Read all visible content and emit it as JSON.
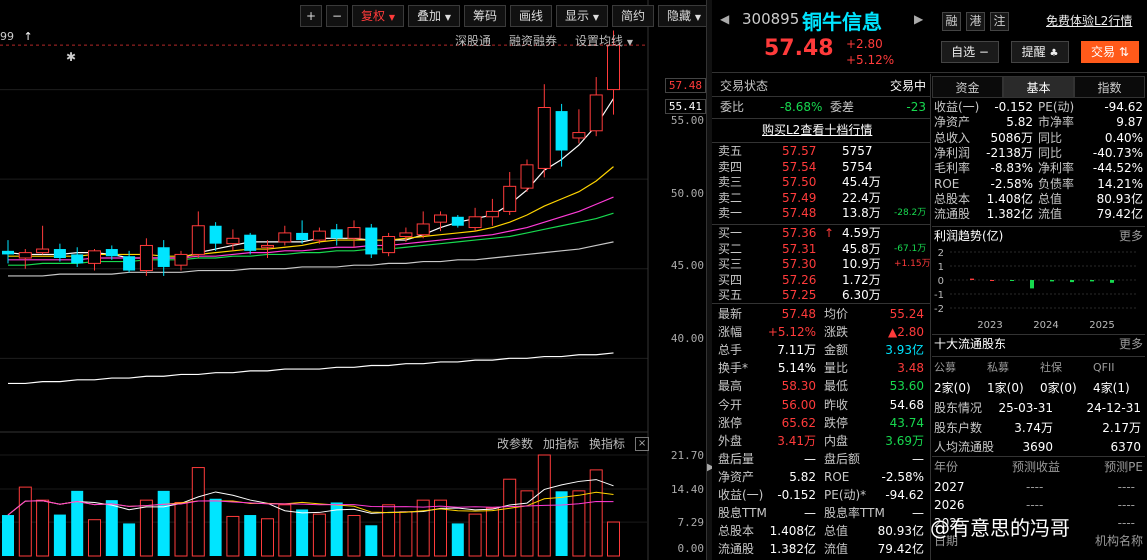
{
  "toolbar": {
    "plus": "+",
    "minus": "−",
    "buttons": [
      "复权",
      "叠加",
      "筹码",
      "画线",
      "显示",
      "简约",
      "隐藏"
    ],
    "arrows": "◀▶",
    "sub": [
      "深股通",
      "融资融券",
      "设置均线"
    ],
    "top_left": "99",
    "top_left_arrow": "↑"
  },
  "price_axis": {
    "ticks": [
      "55.00",
      "50.00",
      "45.00",
      "40.00"
    ],
    "current_tag": "57.48",
    "cross_tag": "55.41",
    "vol_ticks": [
      "21.70",
      "14.40",
      "7.29",
      "0.00"
    ]
  },
  "indicator_bar": [
    "改参数",
    "加指标",
    "换指标"
  ],
  "indicator_close": "×",
  "chart_data": {
    "type": "candlestick",
    "ylim": [
      36,
      60
    ],
    "candles": [
      {
        "o": 46.0,
        "h": 46.6,
        "l": 45.3,
        "c": 45.8
      },
      {
        "o": 45.6,
        "h": 46.1,
        "l": 45.0,
        "c": 45.9
      },
      {
        "o": 45.9,
        "h": 47.4,
        "l": 45.8,
        "c": 46.1
      },
      {
        "o": 46.1,
        "h": 46.4,
        "l": 45.4,
        "c": 45.6
      },
      {
        "o": 45.8,
        "h": 46.2,
        "l": 45.1,
        "c": 45.3
      },
      {
        "o": 45.3,
        "h": 46.1,
        "l": 44.9,
        "c": 46.0
      },
      {
        "o": 46.1,
        "h": 46.3,
        "l": 45.5,
        "c": 45.7
      },
      {
        "o": 45.7,
        "h": 46.0,
        "l": 44.8,
        "c": 44.9
      },
      {
        "o": 44.9,
        "h": 46.7,
        "l": 44.6,
        "c": 46.3
      },
      {
        "o": 46.2,
        "h": 46.6,
        "l": 44.6,
        "c": 45.1
      },
      {
        "o": 45.2,
        "h": 46.0,
        "l": 44.9,
        "c": 45.8
      },
      {
        "o": 45.8,
        "h": 48.2,
        "l": 45.6,
        "c": 47.4
      },
      {
        "o": 47.4,
        "h": 47.6,
        "l": 46.0,
        "c": 46.4
      },
      {
        "o": 46.4,
        "h": 47.2,
        "l": 46.0,
        "c": 46.7
      },
      {
        "o": 46.9,
        "h": 47.0,
        "l": 45.8,
        "c": 46.0
      },
      {
        "o": 46.2,
        "h": 46.6,
        "l": 45.6,
        "c": 46.3
      },
      {
        "o": 46.5,
        "h": 47.4,
        "l": 46.3,
        "c": 47.0
      },
      {
        "o": 47.0,
        "h": 47.7,
        "l": 46.4,
        "c": 46.6
      },
      {
        "o": 46.6,
        "h": 47.3,
        "l": 46.4,
        "c": 47.1
      },
      {
        "o": 47.2,
        "h": 47.5,
        "l": 46.3,
        "c": 46.7
      },
      {
        "o": 46.7,
        "h": 47.7,
        "l": 46.2,
        "c": 47.3
      },
      {
        "o": 47.3,
        "h": 47.5,
        "l": 45.6,
        "c": 45.8
      },
      {
        "o": 45.9,
        "h": 47.0,
        "l": 45.7,
        "c": 46.8
      },
      {
        "o": 46.8,
        "h": 47.3,
        "l": 46.5,
        "c": 47.0
      },
      {
        "o": 46.9,
        "h": 48.2,
        "l": 46.7,
        "c": 47.5
      },
      {
        "o": 47.6,
        "h": 48.2,
        "l": 47.1,
        "c": 48.0
      },
      {
        "o": 47.9,
        "h": 48.0,
        "l": 47.3,
        "c": 47.4
      },
      {
        "o": 47.3,
        "h": 48.4,
        "l": 47.1,
        "c": 47.9
      },
      {
        "o": 47.9,
        "h": 48.9,
        "l": 47.4,
        "c": 48.2
      },
      {
        "o": 48.2,
        "h": 50.4,
        "l": 48.0,
        "c": 49.6
      },
      {
        "o": 49.5,
        "h": 51.1,
        "l": 49.3,
        "c": 50.8
      },
      {
        "o": 50.6,
        "h": 55.3,
        "l": 50.1,
        "c": 54.0
      },
      {
        "o": 53.8,
        "h": 54.2,
        "l": 50.7,
        "c": 51.6
      },
      {
        "o": 52.3,
        "h": 53.9,
        "l": 52.0,
        "c": 52.6
      },
      {
        "o": 52.7,
        "h": 55.7,
        "l": 52.4,
        "c": 54.7
      },
      {
        "o": 55.0,
        "h": 58.3,
        "l": 53.6,
        "c": 57.48
      }
    ],
    "ma": [
      {
        "name": "MA5",
        "color": "#ffffff",
        "values": [
          45.9,
          45.8,
          45.8,
          45.8,
          45.9,
          45.9,
          45.8,
          45.6,
          45.6,
          45.6,
          45.6,
          45.9,
          46.1,
          46.3,
          46.5,
          46.5,
          46.5,
          46.5,
          46.7,
          46.7,
          46.7,
          46.6,
          46.6,
          46.6,
          46.9,
          47.3,
          47.6,
          47.8,
          48.0,
          48.6,
          49.4,
          50.5,
          51.1,
          51.9,
          53.0,
          54.5
        ]
      },
      {
        "name": "MA10",
        "color": "#ffd400",
        "values": [
          45.7,
          45.7,
          45.7,
          45.7,
          45.7,
          45.8,
          45.8,
          45.8,
          45.8,
          45.7,
          45.7,
          45.8,
          45.9,
          46.0,
          46.1,
          46.1,
          46.2,
          46.3,
          46.5,
          46.6,
          46.6,
          46.6,
          46.6,
          46.7,
          46.8,
          46.9,
          47.0,
          47.1,
          47.3,
          47.6,
          48.0,
          48.5,
          48.9,
          49.3,
          49.9,
          50.7
        ]
      },
      {
        "name": "MA20",
        "color": "#ff3bd7",
        "values": [
          45.5,
          45.5,
          45.5,
          45.5,
          45.5,
          45.6,
          45.6,
          45.6,
          45.6,
          45.6,
          45.6,
          45.7,
          45.7,
          45.8,
          45.9,
          45.9,
          46.0,
          46.0,
          46.1,
          46.2,
          46.2,
          46.3,
          46.3,
          46.4,
          46.5,
          46.6,
          46.7,
          46.8,
          46.9,
          47.1,
          47.3,
          47.6,
          47.9,
          48.2,
          48.6,
          49.0
        ]
      },
      {
        "name": "MA30",
        "color": "#17d94f",
        "values": [
          45.2,
          45.2,
          45.3,
          45.3,
          45.3,
          45.4,
          45.4,
          45.4,
          45.5,
          45.5,
          45.5,
          45.6,
          45.6,
          45.7,
          45.7,
          45.8,
          45.8,
          45.9,
          45.9,
          46.0,
          46.0,
          46.1,
          46.1,
          46.2,
          46.3,
          46.4,
          46.5,
          46.6,
          46.7,
          46.8,
          47.0,
          47.2,
          47.4,
          47.6,
          47.8,
          48.1
        ]
      },
      {
        "name": "MA60",
        "color": "#c8c8c8",
        "values": [
          44.6,
          44.6,
          44.6,
          44.7,
          44.7,
          44.7,
          44.7,
          44.8,
          44.8,
          44.8,
          44.8,
          44.9,
          44.9,
          44.9,
          45.0,
          45.0,
          45.0,
          45.1,
          45.1,
          45.1,
          45.2,
          45.2,
          45.3,
          45.3,
          45.4,
          45.4,
          45.5,
          45.5,
          45.6,
          45.7,
          45.8,
          45.9,
          46.0,
          46.1,
          46.3,
          46.5
        ]
      },
      {
        "name": "MA250",
        "color": "#ffffff",
        "values": [
          38.6,
          38.6,
          38.7,
          38.7,
          38.8,
          38.8,
          38.9,
          38.9,
          39.0,
          39.0,
          39.1,
          39.1,
          39.2,
          39.2,
          39.3,
          39.3,
          39.4,
          39.4,
          39.4,
          39.5,
          39.5,
          39.6,
          39.6,
          39.7,
          39.7,
          39.8,
          39.8,
          39.9,
          39.9,
          40.0,
          40.0,
          40.1,
          40.1,
          40.2,
          40.2,
          40.3
        ]
      }
    ],
    "volume": [
      8.8,
      14.8,
      12.0,
      8.9,
      14.0,
      7.8,
      12.0,
      7.0,
      12.0,
      14.0,
      11.5,
      19.0,
      12.3,
      8.5,
      8.8,
      8.0,
      11.0,
      10.0,
      9.0,
      11.5,
      8.7,
      6.6,
      11.0,
      9.5,
      12.0,
      12.0,
      7.0,
      9.0,
      10.3,
      16.5,
      14.0,
      21.7,
      13.9,
      14.0,
      18.5,
      7.3
    ],
    "vol_ylim": [
      0,
      21.7
    ]
  },
  "header": {
    "code": "300895",
    "name": "铜牛信息",
    "badges": [
      "融",
      "港",
      "注"
    ],
    "l2_link": "免费体验L2行情",
    "price": "57.48",
    "change": "+2.80",
    "change_pct": "+5.12%",
    "watch_btn": "自选 −",
    "alert_btn": "提醒",
    "trade_btn": "交易"
  },
  "trade_status": {
    "label": "交易状态",
    "value": "交易中"
  },
  "weibi": {
    "l1": "委比",
    "v1": "-8.68%",
    "l2": "委差",
    "v2": "-23"
  },
  "l2_buy_link": "购买L2查看十档行情",
  "asks": [
    {
      "label": "卖五",
      "price": "57.57",
      "vol": "5757",
      "delta": ""
    },
    {
      "label": "卖四",
      "price": "57.54",
      "vol": "5754",
      "delta": ""
    },
    {
      "label": "卖三",
      "price": "57.50",
      "vol": "45.4万",
      "delta": ""
    },
    {
      "label": "卖二",
      "price": "57.49",
      "vol": "22.4万",
      "delta": ""
    },
    {
      "label": "卖一",
      "price": "57.48",
      "vol": "13.8万",
      "delta": "-28.2万"
    }
  ],
  "bids": [
    {
      "label": "买一",
      "price": "57.36",
      "mark": "↑",
      "vol": "4.59万",
      "delta": "",
      "dcolor": ""
    },
    {
      "label": "买二",
      "price": "57.31",
      "mark": "",
      "vol": "45.8万",
      "delta": "-67.1万",
      "dcolor": "#17d94f"
    },
    {
      "label": "买三",
      "price": "57.30",
      "mark": "",
      "vol": "10.9万",
      "delta": "+1.15万",
      "dcolor": "#ff3b3b"
    },
    {
      "label": "买四",
      "price": "57.26",
      "mark": "",
      "vol": "1.72万",
      "delta": "",
      "dcolor": ""
    },
    {
      "label": "买五",
      "price": "57.25",
      "mark": "",
      "vol": "6.30万",
      "delta": "",
      "dcolor": ""
    }
  ],
  "stats": [
    {
      "l1": "最新",
      "v1": "57.48",
      "c1": "#ff3b3b",
      "l2": "均价",
      "v2": "55.24",
      "c2": "#ff3b3b"
    },
    {
      "l1": "涨幅",
      "v1": "+5.12%",
      "c1": "#ff3b3b",
      "l2": "涨跌",
      "v2": "▲2.80",
      "c2": "#ff3b3b"
    },
    {
      "l1": "总手",
      "v1": "7.11万",
      "c1": "#ffffff",
      "l2": "金额",
      "v2": "3.93亿",
      "c2": "#00e5ff"
    },
    {
      "l1": "换手*",
      "v1": "5.14%",
      "c1": "#ffffff",
      "l2": "量比",
      "v2": "3.48",
      "c2": "#ff3b3b"
    },
    {
      "l1": "最高",
      "v1": "58.30",
      "c1": "#ff3b3b",
      "l2": "最低",
      "v2": "53.60",
      "c2": "#17d94f"
    },
    {
      "l1": "今开",
      "v1": "56.00",
      "c1": "#ff3b3b",
      "l2": "昨收",
      "v2": "54.68",
      "c2": "#ffffff"
    },
    {
      "l1": "涨停",
      "v1": "65.62",
      "c1": "#ff3b3b",
      "l2": "跌停",
      "v2": "43.74",
      "c2": "#17d94f"
    },
    {
      "l1": "外盘",
      "v1": "3.41万",
      "c1": "#ff3b3b",
      "l2": "内盘",
      "v2": "3.69万",
      "c2": "#17d94f"
    },
    {
      "l1": "盘后量",
      "v1": "—",
      "c1": "#ffffff",
      "l2": "盘后额",
      "v2": "—",
      "c2": "#ffffff"
    },
    {
      "l1": "净资产",
      "v1": "5.82",
      "c1": "#ffffff",
      "l2": "ROE",
      "v2": "-2.58%",
      "c2": "#ffffff"
    },
    {
      "l1": "收益(一)",
      "v1": "-0.152",
      "c1": "#ffffff",
      "l2": "PE(动)*",
      "v2": "-94.62",
      "c2": "#ffffff"
    },
    {
      "l1": "股息TTM",
      "v1": "—",
      "c1": "#ffffff",
      "l2": "股息率TTM",
      "v2": "—",
      "c2": "#ffffff"
    },
    {
      "l1": "总股本",
      "v1": "1.408亿",
      "c1": "#ffffff",
      "l2": "总值",
      "v2": "80.93亿",
      "c2": "#ffffff"
    },
    {
      "l1": "流通股",
      "v1": "1.382亿",
      "c1": "#ffffff",
      "l2": "流值",
      "v2": "79.42亿",
      "c2": "#ffffff"
    }
  ],
  "right_tabs": [
    "资金",
    "基本",
    "指数"
  ],
  "fin": [
    {
      "l1": "收益(一)",
      "v1": "-0.152",
      "l2": "PE(动)",
      "v2": "-94.62"
    },
    {
      "l1": "净资产",
      "v1": "5.82",
      "l2": "市净率",
      "v2": "9.87"
    },
    {
      "l1": "总收入",
      "v1": "5086万",
      "l2": "同比",
      "v2": "0.40%"
    },
    {
      "l1": "净利润",
      "v1": "-2138万",
      "l2": "同比",
      "v2": "-40.73%"
    },
    {
      "l1": "毛利率",
      "v1": "-8.83%",
      "l2": "净利率",
      "v2": "-44.52%"
    },
    {
      "l1": "ROE",
      "v1": "-2.58%",
      "l2": "负债率",
      "v2": "14.21%"
    },
    {
      "l1": "总股本",
      "v1": "1.408亿",
      "l2": "总值",
      "v2": "80.93亿"
    },
    {
      "l1": "流通股",
      "v1": "1.382亿",
      "l2": "流值",
      "v2": "79.42亿"
    }
  ],
  "profit_trend": {
    "title": "利润趋势(亿)",
    "more": "更多",
    "yticks": [
      "2",
      "1",
      "0",
      "-1",
      "-2"
    ],
    "years": [
      "2023",
      "2024",
      "2025"
    ],
    "bars": [
      0.1,
      0,
      -0.05,
      -0.6,
      -0.1,
      -0.15,
      -0.1,
      -0.2
    ]
  },
  "holders": {
    "title": "十大流通股东",
    "more": "更多",
    "cats": [
      "公募",
      "私募",
      "社保",
      "QFII"
    ],
    "counts": [
      "2家(0)",
      "1家(0)",
      "0家(0)",
      "4家(1)"
    ],
    "rows": [
      {
        "label": "股东情况",
        "a": "25-03-31",
        "b": "24-12-31"
      },
      {
        "label": "股东户数",
        "a": "3.74万",
        "b": "2.17万"
      },
      {
        "label": "人均流通股",
        "a": "3690",
        "b": "6370"
      }
    ]
  },
  "forecast": {
    "headers": [
      "年份",
      "预测收益",
      "预测PE"
    ],
    "rows": [
      {
        "year": "2027",
        "a": "----",
        "b": "----"
      },
      {
        "year": "2026",
        "a": "----",
        "b": "----"
      },
      {
        "year": "2025",
        "a": "----",
        "b": "----"
      }
    ],
    "footer": "日期",
    "footer_right": "机构名称"
  },
  "watermark": "@有意思的冯哥"
}
